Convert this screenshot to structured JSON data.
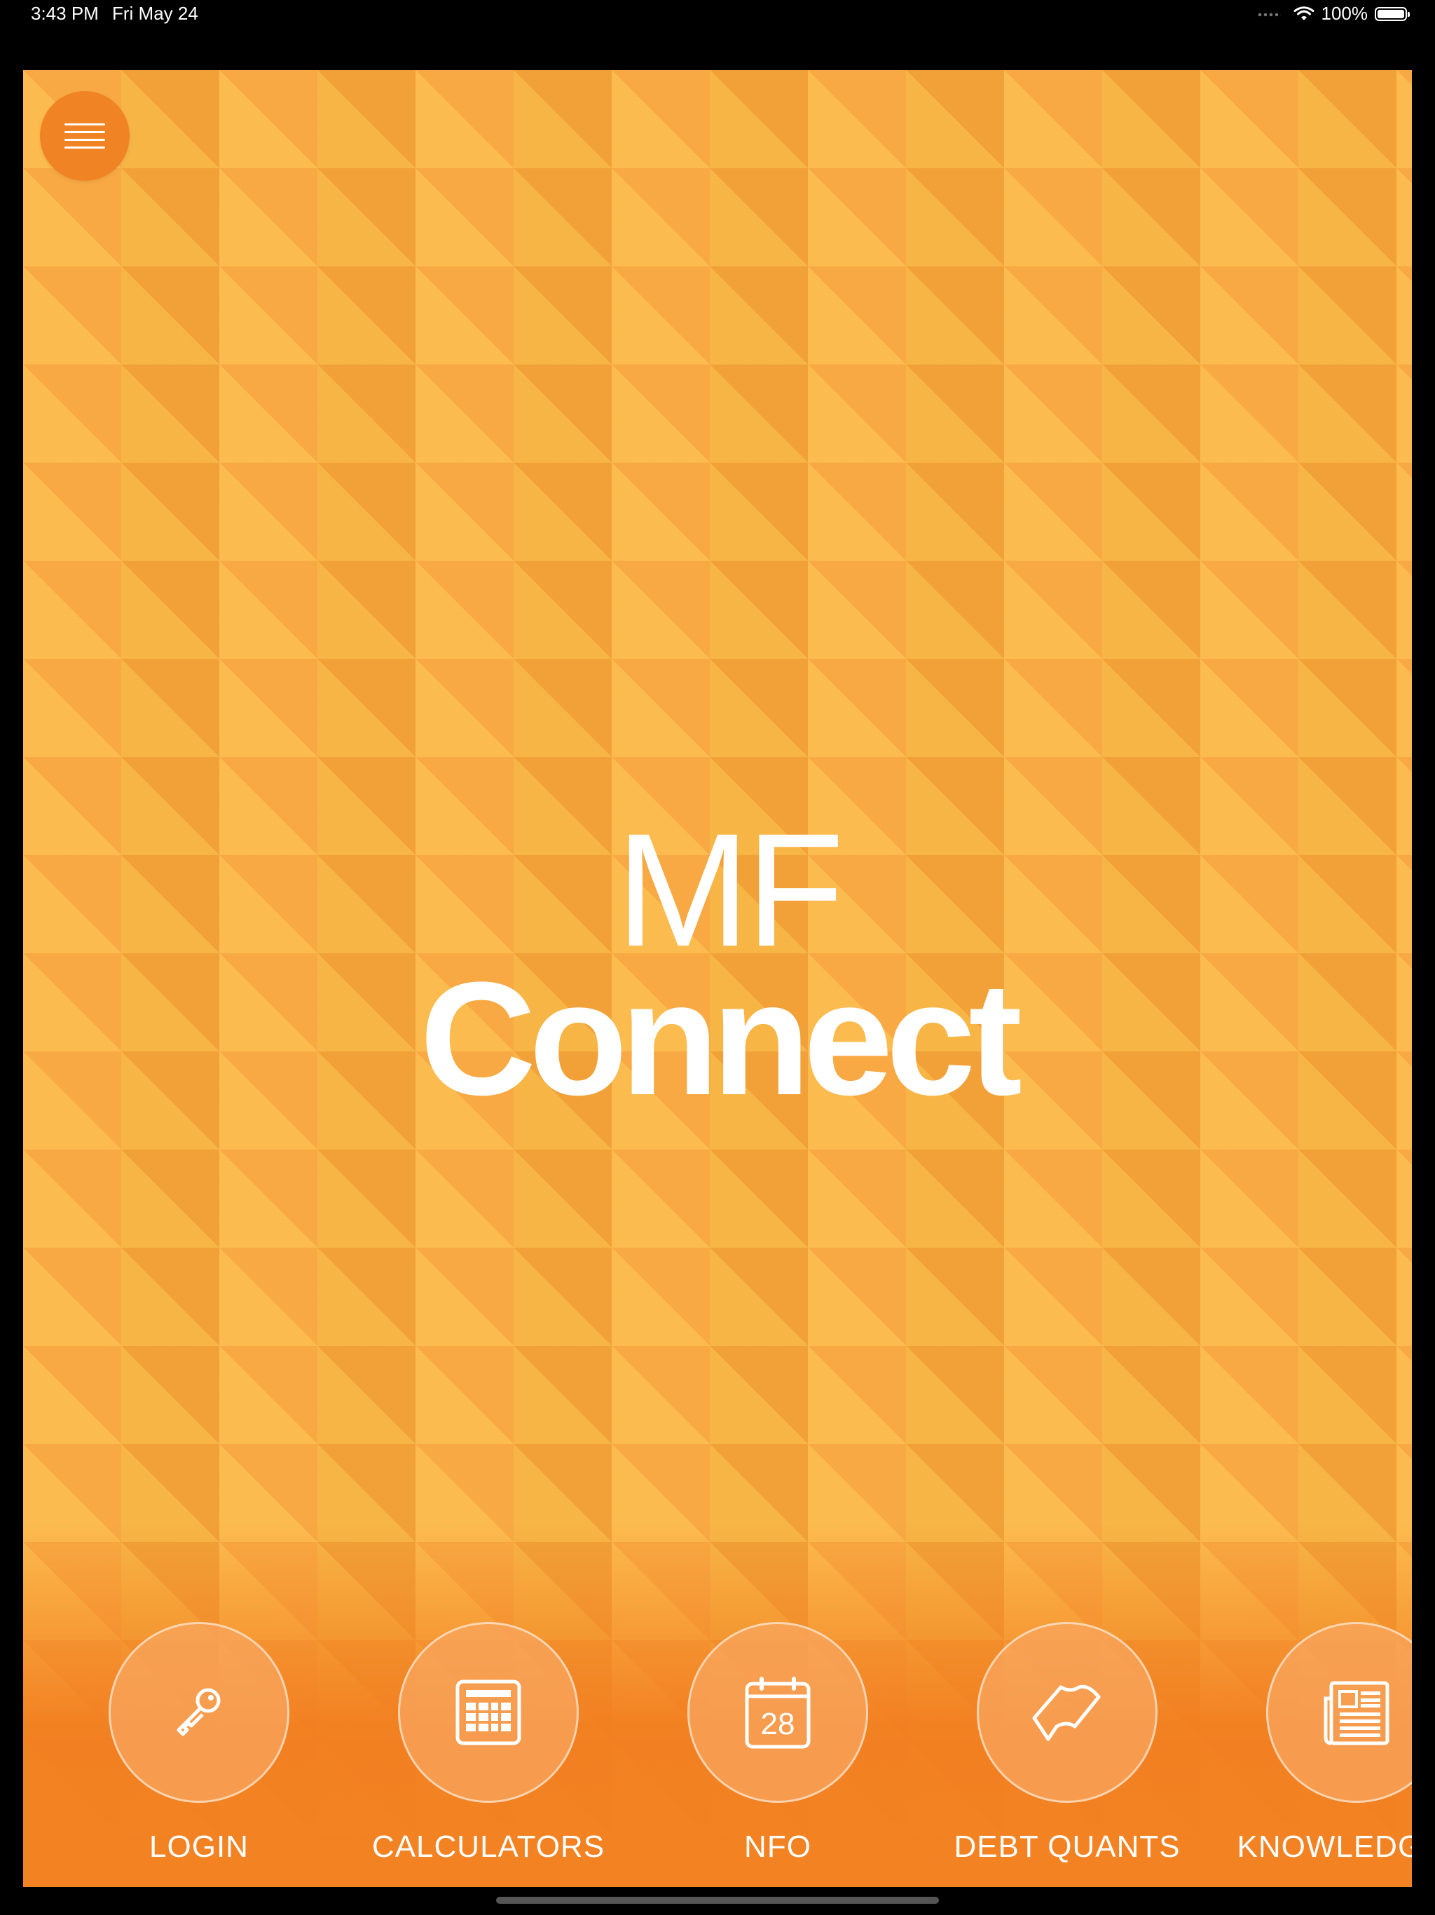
{
  "status_bar": {
    "time": "3:43 PM",
    "date": "Fri May 24",
    "battery": "100%",
    "icons": [
      "cellular-dots-icon",
      "wifi-icon",
      "battery-icon"
    ]
  },
  "header": {
    "menu_icon": "hamburger-menu-icon"
  },
  "logo": {
    "line1": "MF",
    "line2": "Connect"
  },
  "nav": [
    {
      "label": "LOGIN",
      "icon": "key-icon"
    },
    {
      "label": "CALCULATORS",
      "icon": "calculator-icon"
    },
    {
      "label": "NFO",
      "icon": "calendar-icon",
      "icon_text": "28"
    },
    {
      "label": "DEBT QUANTS",
      "icon": "banner-icon"
    },
    {
      "label": "KNOWLEDGE C",
      "icon": "newspaper-icon"
    }
  ],
  "colors": {
    "background": "#fbab3e",
    "bottom_gradient": "#f28222",
    "menu_button": "#f08424",
    "text": "#ffffff"
  }
}
